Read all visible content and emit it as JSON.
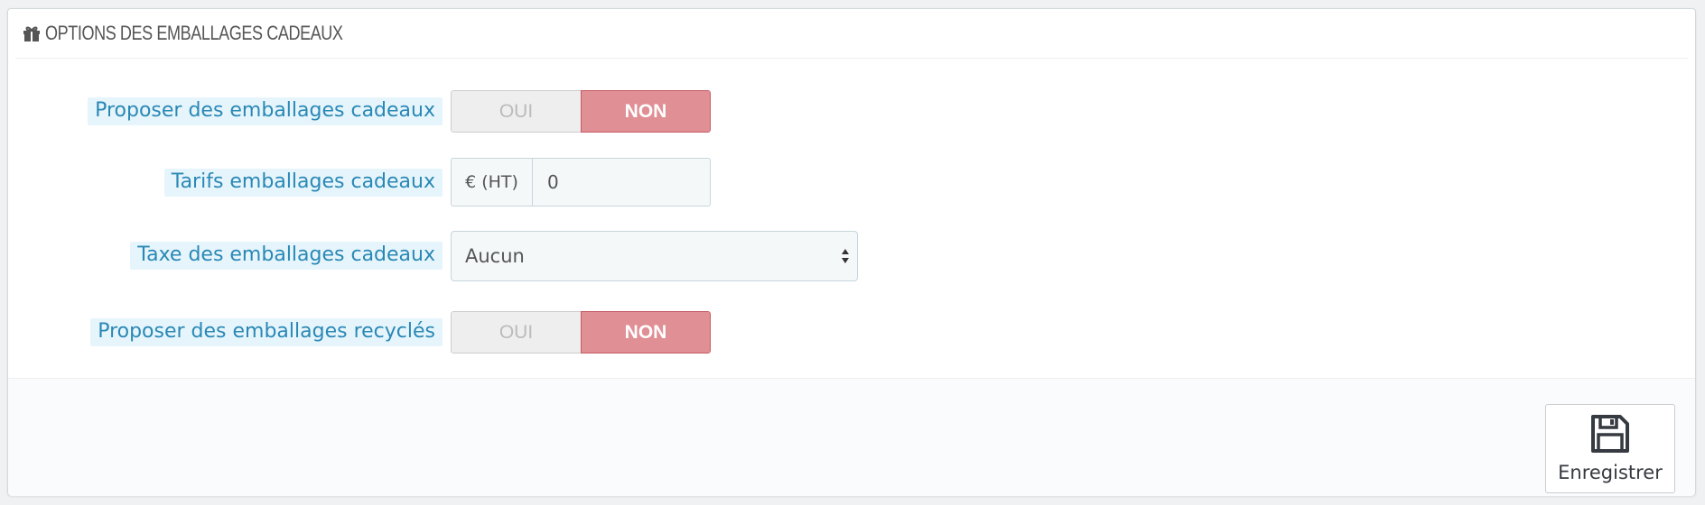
{
  "panel": {
    "heading": "OPTIONS DES EMBALLAGES CADEAUX",
    "heading_icon": "gift-icon"
  },
  "fields": {
    "gift_wrapping": {
      "label": "Proposer des emballages cadeaux",
      "yes": "OUI",
      "no": "NON",
      "selected": "NON"
    },
    "gift_price": {
      "label": "Tarifs emballages cadeaux",
      "addon": "€ (HT)",
      "value": "0"
    },
    "gift_tax": {
      "label": "Taxe des emballages cadeaux",
      "selected": "Aucun"
    },
    "recycled": {
      "label": "Proposer des emballages recyclés",
      "yes": "OUI",
      "no": "NON",
      "selected": "NON"
    }
  },
  "footer": {
    "save_label": "Enregistrer",
    "save_icon": "floppy-disk-icon"
  },
  "colors": {
    "label_text": "#2a88b6",
    "label_bg": "#e6f5fb",
    "switch_no_bg": "#e08f95",
    "switch_yes_bg": "#eeeeee"
  }
}
